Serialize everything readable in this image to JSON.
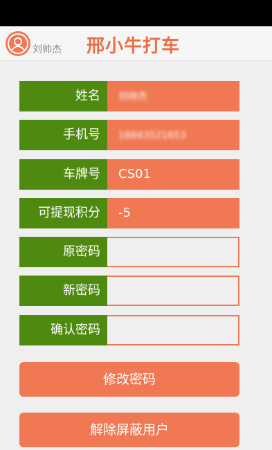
{
  "header": {
    "username": "刘帅杰",
    "title": "邢小牛打车"
  },
  "profile": {
    "name_label": "姓名",
    "name_value": "刘帅杰",
    "phone_label": "手机号",
    "phone_value": "18843521653",
    "plate_label": "车牌号",
    "plate_value": "CS01",
    "points_label": "可提现积分",
    "points_value": "-5"
  },
  "password_form": {
    "old_label": "原密码",
    "new_label": "新密码",
    "confirm_label": "确认密码"
  },
  "buttons": {
    "change_password": "修改密码",
    "unblock_user": "解除屏蔽用户"
  },
  "colors": {
    "label_bg": "#4f8a10",
    "accent": "#f07852",
    "title": "#ee6c45"
  }
}
